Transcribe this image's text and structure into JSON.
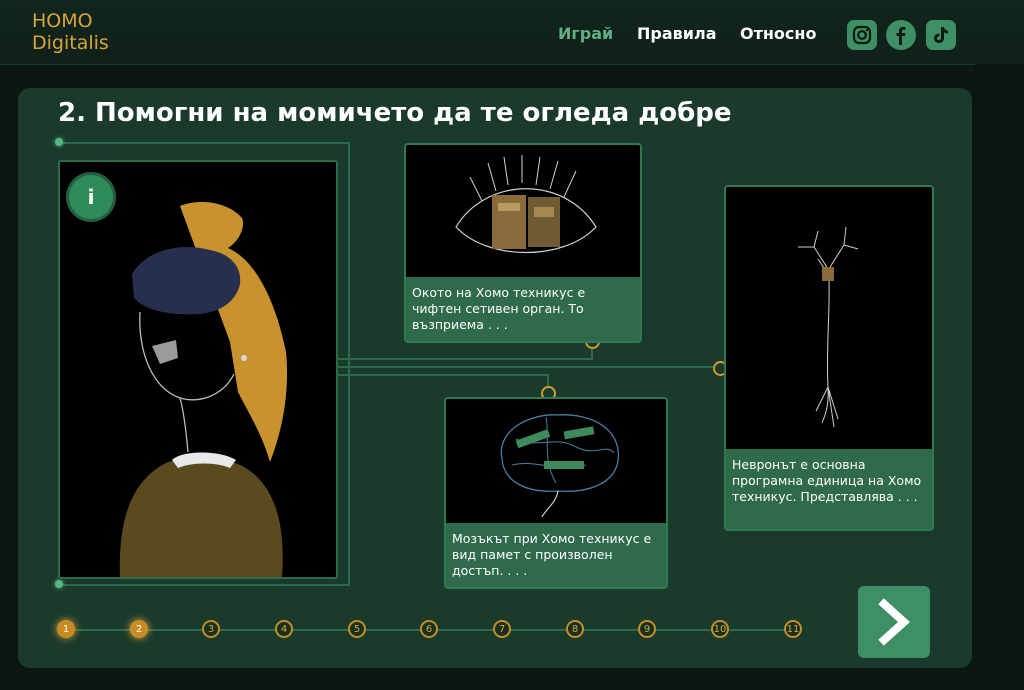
{
  "header": {
    "logo_line1": "HOMO",
    "logo_line2": "Digitalis",
    "nav": [
      {
        "label": "Играй",
        "active": true
      },
      {
        "label": "Правила",
        "active": false
      },
      {
        "label": "Относно",
        "active": false
      }
    ],
    "social_icons": [
      "instagram-icon",
      "facebook-icon",
      "tiktok-icon"
    ]
  },
  "main": {
    "title": "2. Помогни на момичето да те огледа добре",
    "info_label": "i",
    "cards": [
      {
        "text": "Окото на Хомо техникус е чифтен сетивен орган. То възприема . . ."
      },
      {
        "text": "Мозъкът при Хомо техникус е вид памет с произволен достъп. . . ."
      },
      {
        "text": "Невронът е основна програмна единица на Хомо техникус. Представлява . . ."
      }
    ]
  },
  "progress": {
    "steps": [
      "1",
      "2",
      "3",
      "4",
      "5",
      "6",
      "7",
      "8",
      "9",
      "10",
      "11"
    ],
    "completed": 2
  },
  "colors": {
    "accent_green": "#3f8f66",
    "accent_orange": "#d7a53b",
    "panel": "#1a3a2b"
  }
}
